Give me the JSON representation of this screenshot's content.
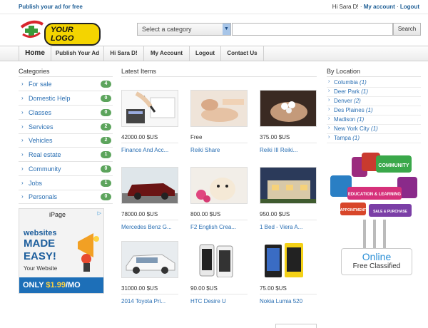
{
  "topbar": {
    "publish": "Publish your ad for free",
    "greeting": "Hi Sara D!",
    "sep": " · ",
    "my_account": "My account",
    "logout": "Logout"
  },
  "header": {
    "logo_text": "YOUR LOGO",
    "category_select": "Select a category",
    "search_button": "Search"
  },
  "nav": [
    "Home",
    "Publish Your Ad",
    "Hi Sara D!",
    "My Account",
    "Logout",
    "Contact Us"
  ],
  "categories": {
    "title": "Categories",
    "items": [
      {
        "label": "For sale",
        "count": "4"
      },
      {
        "label": "Domestic Help",
        "count": "0"
      },
      {
        "label": "Classes",
        "count": "0"
      },
      {
        "label": "Services",
        "count": "2"
      },
      {
        "label": "Vehicles",
        "count": "2"
      },
      {
        "label": "Real estate",
        "count": "1"
      },
      {
        "label": "Community",
        "count": "0"
      },
      {
        "label": "Jobs",
        "count": "1"
      },
      {
        "label": "Personals",
        "count": "0"
      }
    ]
  },
  "ad": {
    "brand": "iPage",
    "choices": "▷",
    "line1": "websites",
    "line2": "MADE",
    "line3": "EASY!",
    "line4": "Your Website",
    "only": "ONLY ",
    "price": "$1.99",
    "per": "/MO"
  },
  "latest": {
    "title": "Latest Items",
    "items": [
      {
        "price": "42000.00 $US",
        "title": "Finance And Acc..."
      },
      {
        "price": "Free",
        "title": "Reiki Share"
      },
      {
        "price": "375.00 $US",
        "title": "Reiki III Reiki..."
      },
      {
        "price": "78000.00 $US",
        "title": "Mercedes Benz G..."
      },
      {
        "price": "800.00 $US",
        "title": "F2 English Crea..."
      },
      {
        "price": "950.00 $US",
        "title": "1 Bed - Viera A..."
      },
      {
        "price": "31000.00 $US",
        "title": "2014 Toyota Pri..."
      },
      {
        "price": "90.00 $US",
        "title": "HTC Desire U"
      },
      {
        "price": "75.00 $US",
        "title": "Nokia Lumia 520"
      }
    ]
  },
  "locations": {
    "title": "By Location",
    "items": [
      {
        "label": "Columbia",
        "count": "(1)"
      },
      {
        "label": "Deer Park",
        "count": "(1)"
      },
      {
        "label": "Denver",
        "count": "(2)"
      },
      {
        "label": "Des Plaines",
        "count": "(1)"
      },
      {
        "label": "Madison",
        "count": "(1)"
      },
      {
        "label": "New York City",
        "count": "(1)"
      },
      {
        "label": "Tampa",
        "count": "(1)"
      }
    ]
  },
  "promo": {
    "sign1": "COMMUNITY",
    "sign2": "EDUCATION & LEARNING",
    "sign3": "SALE & PURCHASE",
    "sign4": "APPOINTMENT",
    "online": "Online",
    "free_classified": "Free Classified"
  },
  "colors": {
    "badge": "#5ca45c",
    "link": "#2a6fb3",
    "brand": "#1f5f96"
  }
}
